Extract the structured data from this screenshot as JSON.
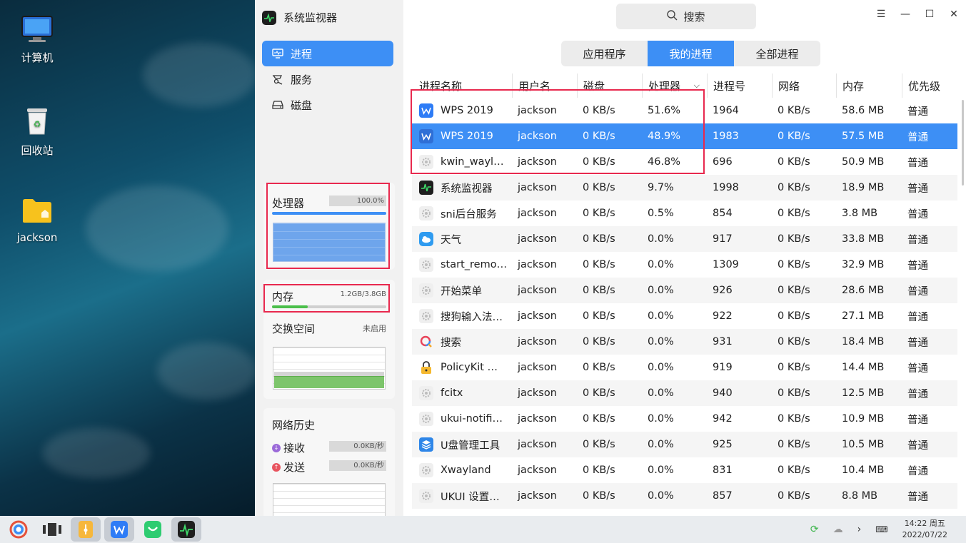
{
  "desktop": {
    "icons": [
      {
        "label": "计算机"
      },
      {
        "label": "回收站"
      },
      {
        "label": "jackson"
      }
    ]
  },
  "app": {
    "title": "系统监视器"
  },
  "nav": [
    {
      "label": "进程",
      "active": true
    },
    {
      "label": "服务",
      "active": false
    },
    {
      "label": "磁盘",
      "active": false
    }
  ],
  "cpu": {
    "label": "处理器",
    "percent_text": "100.0%",
    "percent": 100
  },
  "memory": {
    "label": "内存",
    "value": "1.2GB/3.8GB",
    "fraction": 0.31
  },
  "swap": {
    "label": "交换空间",
    "status": "未启用"
  },
  "network": {
    "title": "网络历史",
    "receive_label": "接收",
    "receive_value": "0.0KB/秒",
    "send_label": "发送",
    "send_value": "0.0KB/秒"
  },
  "search": {
    "placeholder": "搜索"
  },
  "tabs": [
    {
      "label": "应用程序",
      "active": false
    },
    {
      "label": "我的进程",
      "active": true
    },
    {
      "label": "全部进程",
      "active": false
    }
  ],
  "table": {
    "columns": [
      "进程名称",
      "用户名",
      "磁盘",
      "处理器",
      "进程号",
      "网络",
      "内存",
      "优先级"
    ],
    "rows": [
      {
        "name": "WPS 2019",
        "icon": "wps-icon",
        "user": "jackson",
        "disk": "0 KB/s",
        "cpu": "51.6%",
        "pid": "1964",
        "net": "0 KB/s",
        "mem": "58.6 MB",
        "prio": "普通"
      },
      {
        "name": "WPS 2019",
        "icon": "wps-icon",
        "user": "jackson",
        "disk": "0 KB/s",
        "cpu": "48.9%",
        "pid": "1983",
        "net": "0 KB/s",
        "mem": "57.5 MB",
        "prio": "普通",
        "selected": true
      },
      {
        "name": "kwin_wayl…",
        "icon": "gear-icon",
        "user": "jackson",
        "disk": "0 KB/s",
        "cpu": "46.8%",
        "pid": "696",
        "net": "0 KB/s",
        "mem": "50.9 MB",
        "prio": "普通"
      },
      {
        "name": "系统监视器",
        "icon": "monitor-icon",
        "user": "jackson",
        "disk": "0 KB/s",
        "cpu": "9.7%",
        "pid": "1998",
        "net": "0 KB/s",
        "mem": "18.9 MB",
        "prio": "普通"
      },
      {
        "name": "sni后台服务",
        "icon": "gear-icon",
        "user": "jackson",
        "disk": "0 KB/s",
        "cpu": "0.5%",
        "pid": "854",
        "net": "0 KB/s",
        "mem": "3.8 MB",
        "prio": "普通"
      },
      {
        "name": "天气",
        "icon": "weather-icon",
        "user": "jackson",
        "disk": "0 KB/s",
        "cpu": "0.0%",
        "pid": "917",
        "net": "0 KB/s",
        "mem": "33.8 MB",
        "prio": "普通"
      },
      {
        "name": "start_remo…",
        "icon": "gear-icon",
        "user": "jackson",
        "disk": "0 KB/s",
        "cpu": "0.0%",
        "pid": "1309",
        "net": "0 KB/s",
        "mem": "32.9 MB",
        "prio": "普通"
      },
      {
        "name": "开始菜单",
        "icon": "gear-icon",
        "user": "jackson",
        "disk": "0 KB/s",
        "cpu": "0.0%",
        "pid": "926",
        "net": "0 KB/s",
        "mem": "28.6 MB",
        "prio": "普通"
      },
      {
        "name": "搜狗输入法…",
        "icon": "gear-icon",
        "user": "jackson",
        "disk": "0 KB/s",
        "cpu": "0.0%",
        "pid": "922",
        "net": "0 KB/s",
        "mem": "27.1 MB",
        "prio": "普通"
      },
      {
        "name": "搜索",
        "icon": "search-app-icon",
        "user": "jackson",
        "disk": "0 KB/s",
        "cpu": "0.0%",
        "pid": "931",
        "net": "0 KB/s",
        "mem": "18.4 MB",
        "prio": "普通"
      },
      {
        "name": "PolicyKit …",
        "icon": "lock-icon",
        "user": "jackson",
        "disk": "0 KB/s",
        "cpu": "0.0%",
        "pid": "919",
        "net": "0 KB/s",
        "mem": "14.4 MB",
        "prio": "普通"
      },
      {
        "name": "fcitx",
        "icon": "gear-icon",
        "user": "jackson",
        "disk": "0 KB/s",
        "cpu": "0.0%",
        "pid": "940",
        "net": "0 KB/s",
        "mem": "12.5 MB",
        "prio": "普通"
      },
      {
        "name": "ukui-notifi…",
        "icon": "gear-icon",
        "user": "jackson",
        "disk": "0 KB/s",
        "cpu": "0.0%",
        "pid": "942",
        "net": "0 KB/s",
        "mem": "10.9 MB",
        "prio": "普通"
      },
      {
        "name": "U盘管理工具",
        "icon": "usb-manager-icon",
        "user": "jackson",
        "disk": "0 KB/s",
        "cpu": "0.0%",
        "pid": "925",
        "net": "0 KB/s",
        "mem": "10.5 MB",
        "prio": "普通"
      },
      {
        "name": "Xwayland",
        "icon": "gear-icon",
        "user": "jackson",
        "disk": "0 KB/s",
        "cpu": "0.0%",
        "pid": "831",
        "net": "0 KB/s",
        "mem": "10.4 MB",
        "prio": "普通"
      },
      {
        "name": "UKUI 设置…",
        "icon": "gear-icon",
        "user": "jackson",
        "disk": "0 KB/s",
        "cpu": "0.0%",
        "pid": "857",
        "net": "0 KB/s",
        "mem": "8.8 MB",
        "prio": "普通"
      }
    ]
  },
  "taskbar": {
    "clock_time": "14:22 周五",
    "clock_date": "2022/07/22"
  },
  "colors": {
    "accent": "#3d8ff5",
    "highlight": "#e8294e",
    "memory_green": "#4bbf4b"
  }
}
